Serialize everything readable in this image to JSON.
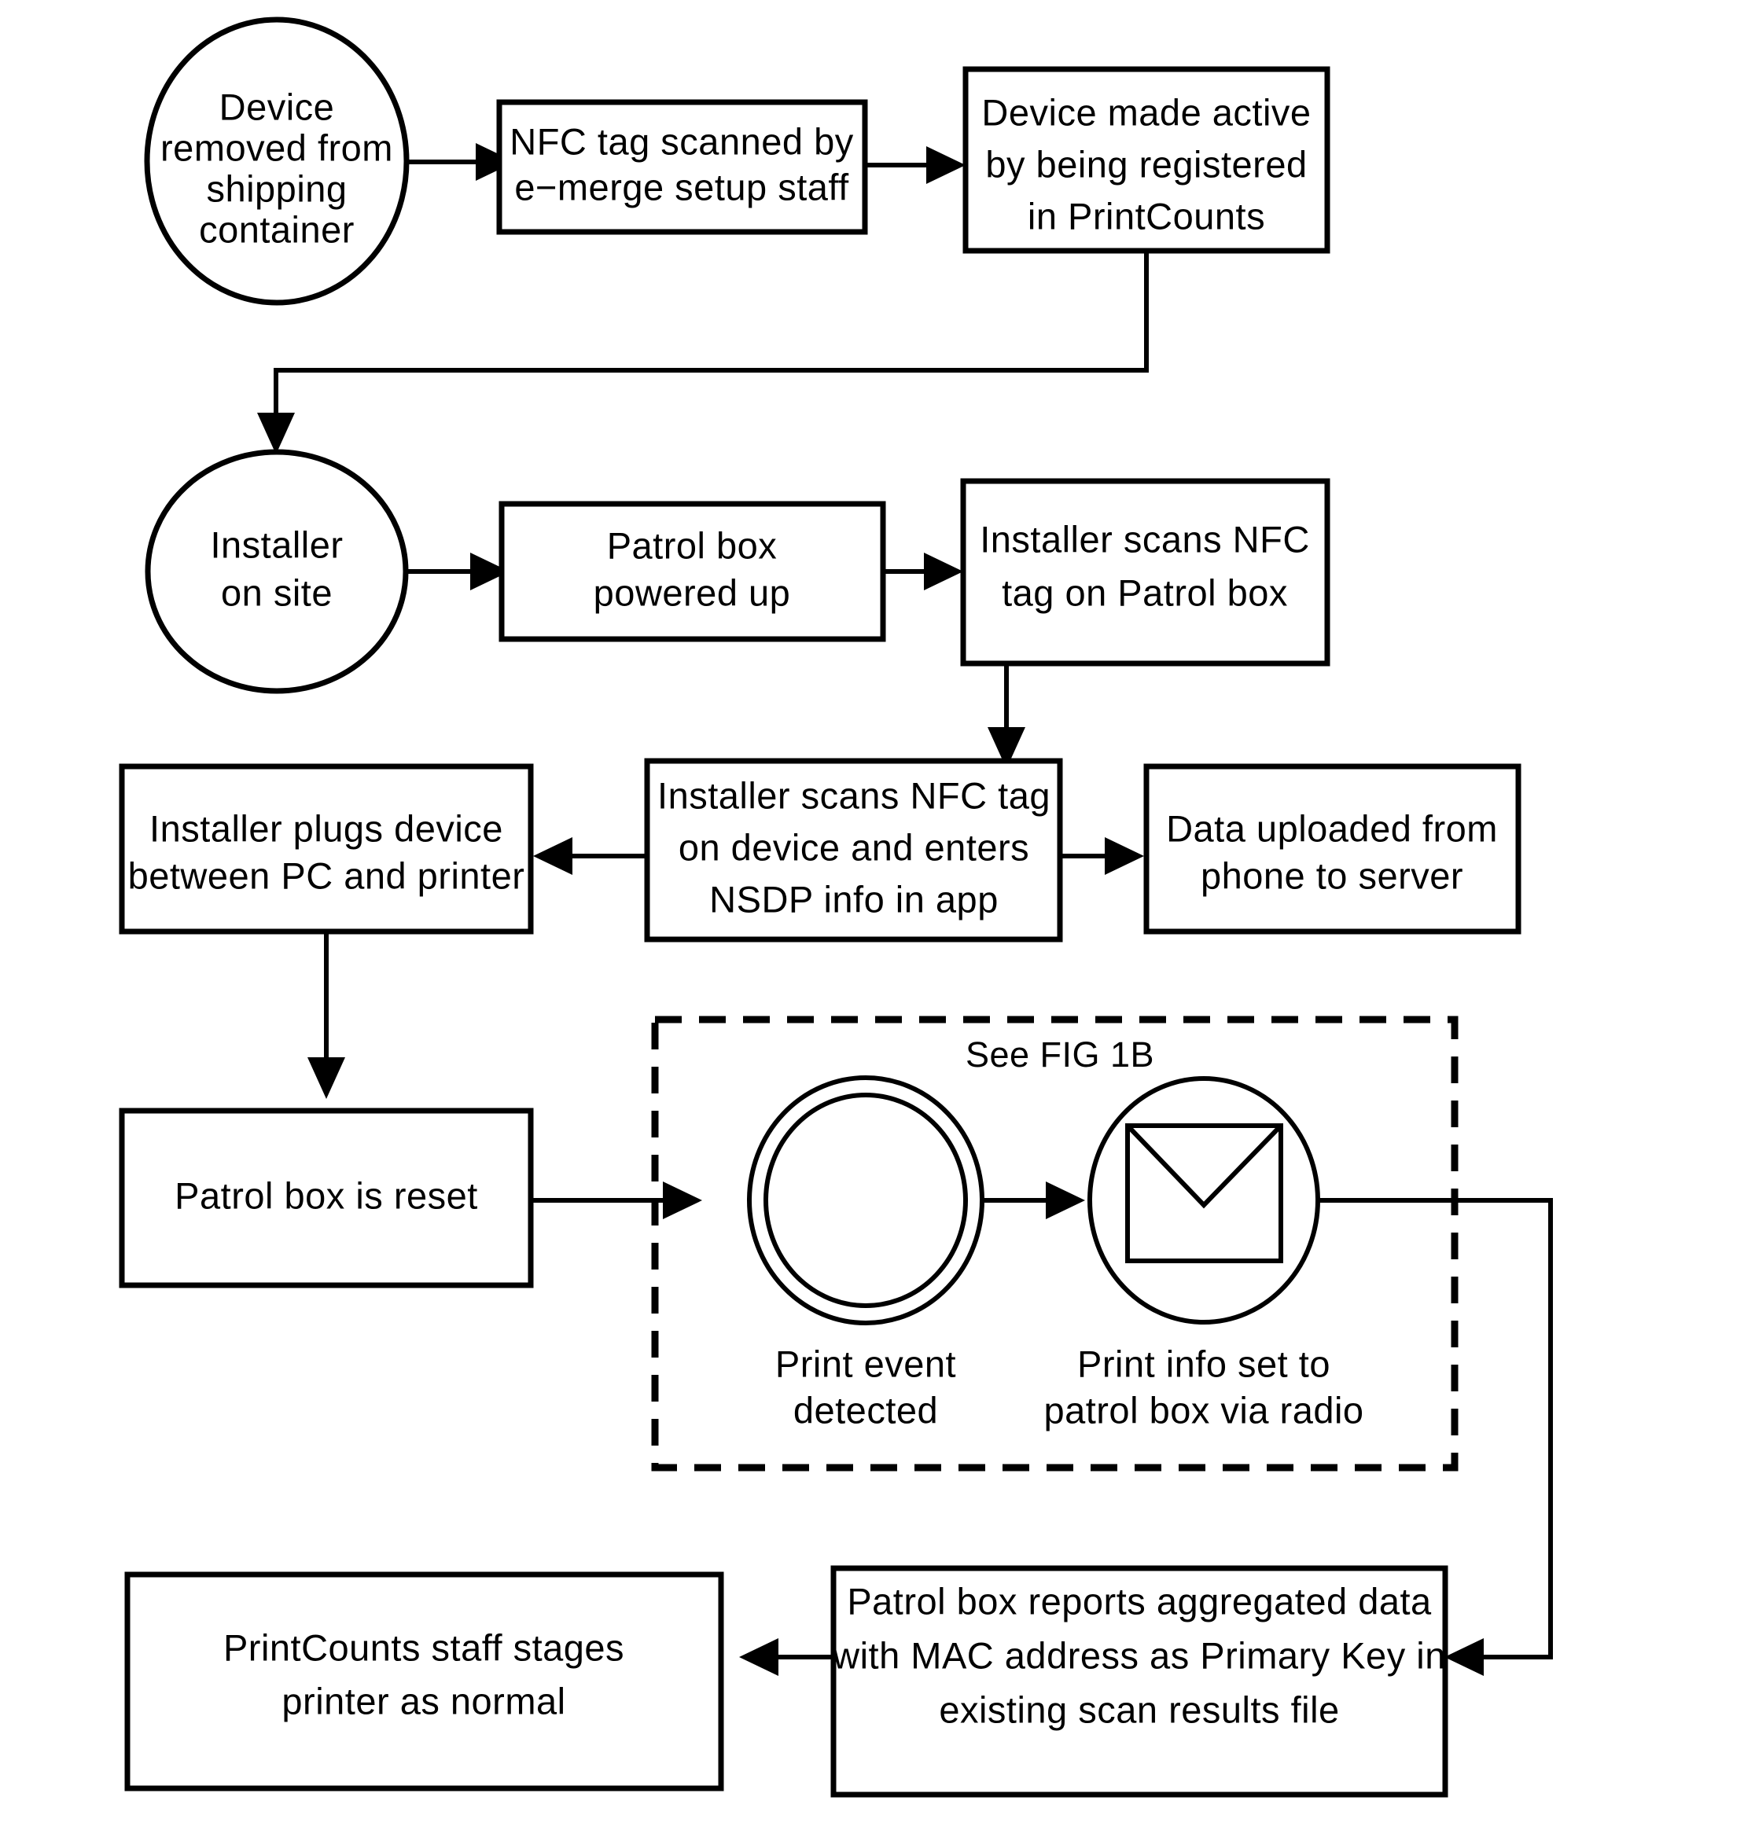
{
  "figure": {
    "type": "flowchart",
    "orientation": "top-to-bottom",
    "note_label": "See FIG 1B"
  },
  "nodes": {
    "n1": {
      "id": "device-removed",
      "shape": "ellipse",
      "lines": [
        "Device",
        "removed from",
        "shipping",
        "container"
      ]
    },
    "n2": {
      "id": "nfc-tag-scanned",
      "shape": "rect",
      "lines": [
        "NFC tag scanned by",
        "e−merge setup staff"
      ]
    },
    "n3": {
      "id": "device-made-active",
      "shape": "rect",
      "lines": [
        "Device made active",
        "by being registered",
        "in PrintCounts"
      ]
    },
    "n4": {
      "id": "installer-on-site",
      "shape": "ellipse",
      "lines": [
        "Installer",
        "on site"
      ]
    },
    "n5": {
      "id": "patrol-box-powered-up",
      "shape": "rect",
      "lines": [
        "Patrol box",
        "powered up"
      ]
    },
    "n6": {
      "id": "installer-scans-patrol-box",
      "shape": "rect",
      "lines": [
        "Installer scans NFC",
        "tag on Patrol box"
      ]
    },
    "n7": {
      "id": "installer-plugs-device",
      "shape": "rect",
      "lines": [
        "Installer plugs device",
        "between PC and printer"
      ]
    },
    "n8": {
      "id": "installer-scans-device",
      "shape": "rect",
      "lines": [
        "Installer scans NFC tag",
        "on device and enters",
        "NSDP info in app"
      ]
    },
    "n9": {
      "id": "data-uploaded",
      "shape": "rect",
      "lines": [
        "Data uploaded from",
        "phone to server"
      ]
    },
    "n10": {
      "id": "patrol-box-reset",
      "shape": "rect",
      "lines": [
        "Patrol box is reset"
      ]
    },
    "n11": {
      "id": "print-event-detected",
      "shape": "double-circle",
      "caption": [
        "Print event",
        "detected"
      ]
    },
    "n12": {
      "id": "print-info-set",
      "shape": "circle-envelope",
      "caption": [
        "Print info set to",
        "patrol box via radio"
      ]
    },
    "n13": {
      "id": "patrol-box-reports",
      "shape": "rect",
      "lines": [
        "Patrol box reports aggregated data",
        "with MAC address as Primary Key in",
        "existing scan results file"
      ]
    },
    "n14": {
      "id": "printcounts-staff-stages",
      "shape": "rect",
      "lines": [
        "PrintCounts staff stages",
        "printer as normal"
      ]
    }
  },
  "edges": [
    {
      "from": "device-removed",
      "to": "nfc-tag-scanned",
      "style": "solid-arrow"
    },
    {
      "from": "nfc-tag-scanned",
      "to": "device-made-active",
      "style": "solid-arrow"
    },
    {
      "from": "device-made-active",
      "to": "installer-on-site",
      "style": "solid-arrow-elbow"
    },
    {
      "from": "installer-on-site",
      "to": "patrol-box-powered-up",
      "style": "solid-arrow"
    },
    {
      "from": "patrol-box-powered-up",
      "to": "installer-scans-patrol-box",
      "style": "solid-arrow"
    },
    {
      "from": "installer-scans-patrol-box",
      "to": "installer-scans-device",
      "style": "solid-arrow"
    },
    {
      "from": "installer-scans-device",
      "to": "installer-plugs-device",
      "style": "solid-arrow"
    },
    {
      "from": "installer-scans-device",
      "to": "data-uploaded",
      "style": "solid-arrow"
    },
    {
      "from": "installer-plugs-device",
      "to": "patrol-box-reset",
      "style": "solid-arrow"
    },
    {
      "from": "patrol-box-reset",
      "to": "print-event-detected",
      "style": "solid-arrow"
    },
    {
      "from": "print-event-detected",
      "to": "print-info-set",
      "style": "solid-arrow"
    },
    {
      "from": "print-info-set",
      "to": "patrol-box-reports",
      "style": "solid-arrow-elbow"
    },
    {
      "from": "patrol-box-reports",
      "to": "printcounts-staff-stages",
      "style": "solid-arrow"
    }
  ],
  "colors": {
    "stroke": "#000000",
    "fill": "#ffffff",
    "background": "#ffffff"
  }
}
